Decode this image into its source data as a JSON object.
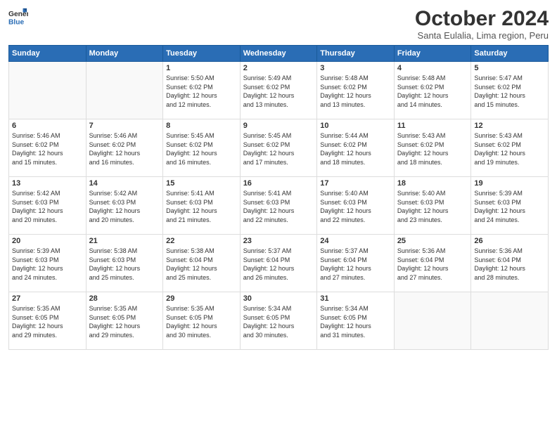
{
  "logo": {
    "general": "General",
    "blue": "Blue"
  },
  "header": {
    "month": "October 2024",
    "location": "Santa Eulalia, Lima region, Peru"
  },
  "weekdays": [
    "Sunday",
    "Monday",
    "Tuesday",
    "Wednesday",
    "Thursday",
    "Friday",
    "Saturday"
  ],
  "weeks": [
    [
      {
        "day": "",
        "info": ""
      },
      {
        "day": "",
        "info": ""
      },
      {
        "day": "1",
        "info": "Sunrise: 5:50 AM\nSunset: 6:02 PM\nDaylight: 12 hours\nand 12 minutes."
      },
      {
        "day": "2",
        "info": "Sunrise: 5:49 AM\nSunset: 6:02 PM\nDaylight: 12 hours\nand 13 minutes."
      },
      {
        "day": "3",
        "info": "Sunrise: 5:48 AM\nSunset: 6:02 PM\nDaylight: 12 hours\nand 13 minutes."
      },
      {
        "day": "4",
        "info": "Sunrise: 5:48 AM\nSunset: 6:02 PM\nDaylight: 12 hours\nand 14 minutes."
      },
      {
        "day": "5",
        "info": "Sunrise: 5:47 AM\nSunset: 6:02 PM\nDaylight: 12 hours\nand 15 minutes."
      }
    ],
    [
      {
        "day": "6",
        "info": "Sunrise: 5:46 AM\nSunset: 6:02 PM\nDaylight: 12 hours\nand 15 minutes."
      },
      {
        "day": "7",
        "info": "Sunrise: 5:46 AM\nSunset: 6:02 PM\nDaylight: 12 hours\nand 16 minutes."
      },
      {
        "day": "8",
        "info": "Sunrise: 5:45 AM\nSunset: 6:02 PM\nDaylight: 12 hours\nand 16 minutes."
      },
      {
        "day": "9",
        "info": "Sunrise: 5:45 AM\nSunset: 6:02 PM\nDaylight: 12 hours\nand 17 minutes."
      },
      {
        "day": "10",
        "info": "Sunrise: 5:44 AM\nSunset: 6:02 PM\nDaylight: 12 hours\nand 18 minutes."
      },
      {
        "day": "11",
        "info": "Sunrise: 5:43 AM\nSunset: 6:02 PM\nDaylight: 12 hours\nand 18 minutes."
      },
      {
        "day": "12",
        "info": "Sunrise: 5:43 AM\nSunset: 6:02 PM\nDaylight: 12 hours\nand 19 minutes."
      }
    ],
    [
      {
        "day": "13",
        "info": "Sunrise: 5:42 AM\nSunset: 6:03 PM\nDaylight: 12 hours\nand 20 minutes."
      },
      {
        "day": "14",
        "info": "Sunrise: 5:42 AM\nSunset: 6:03 PM\nDaylight: 12 hours\nand 20 minutes."
      },
      {
        "day": "15",
        "info": "Sunrise: 5:41 AM\nSunset: 6:03 PM\nDaylight: 12 hours\nand 21 minutes."
      },
      {
        "day": "16",
        "info": "Sunrise: 5:41 AM\nSunset: 6:03 PM\nDaylight: 12 hours\nand 22 minutes."
      },
      {
        "day": "17",
        "info": "Sunrise: 5:40 AM\nSunset: 6:03 PM\nDaylight: 12 hours\nand 22 minutes."
      },
      {
        "day": "18",
        "info": "Sunrise: 5:40 AM\nSunset: 6:03 PM\nDaylight: 12 hours\nand 23 minutes."
      },
      {
        "day": "19",
        "info": "Sunrise: 5:39 AM\nSunset: 6:03 PM\nDaylight: 12 hours\nand 24 minutes."
      }
    ],
    [
      {
        "day": "20",
        "info": "Sunrise: 5:39 AM\nSunset: 6:03 PM\nDaylight: 12 hours\nand 24 minutes."
      },
      {
        "day": "21",
        "info": "Sunrise: 5:38 AM\nSunset: 6:03 PM\nDaylight: 12 hours\nand 25 minutes."
      },
      {
        "day": "22",
        "info": "Sunrise: 5:38 AM\nSunset: 6:04 PM\nDaylight: 12 hours\nand 25 minutes."
      },
      {
        "day": "23",
        "info": "Sunrise: 5:37 AM\nSunset: 6:04 PM\nDaylight: 12 hours\nand 26 minutes."
      },
      {
        "day": "24",
        "info": "Sunrise: 5:37 AM\nSunset: 6:04 PM\nDaylight: 12 hours\nand 27 minutes."
      },
      {
        "day": "25",
        "info": "Sunrise: 5:36 AM\nSunset: 6:04 PM\nDaylight: 12 hours\nand 27 minutes."
      },
      {
        "day": "26",
        "info": "Sunrise: 5:36 AM\nSunset: 6:04 PM\nDaylight: 12 hours\nand 28 minutes."
      }
    ],
    [
      {
        "day": "27",
        "info": "Sunrise: 5:35 AM\nSunset: 6:05 PM\nDaylight: 12 hours\nand 29 minutes."
      },
      {
        "day": "28",
        "info": "Sunrise: 5:35 AM\nSunset: 6:05 PM\nDaylight: 12 hours\nand 29 minutes."
      },
      {
        "day": "29",
        "info": "Sunrise: 5:35 AM\nSunset: 6:05 PM\nDaylight: 12 hours\nand 30 minutes."
      },
      {
        "day": "30",
        "info": "Sunrise: 5:34 AM\nSunset: 6:05 PM\nDaylight: 12 hours\nand 30 minutes."
      },
      {
        "day": "31",
        "info": "Sunrise: 5:34 AM\nSunset: 6:05 PM\nDaylight: 12 hours\nand 31 minutes."
      },
      {
        "day": "",
        "info": ""
      },
      {
        "day": "",
        "info": ""
      }
    ]
  ]
}
